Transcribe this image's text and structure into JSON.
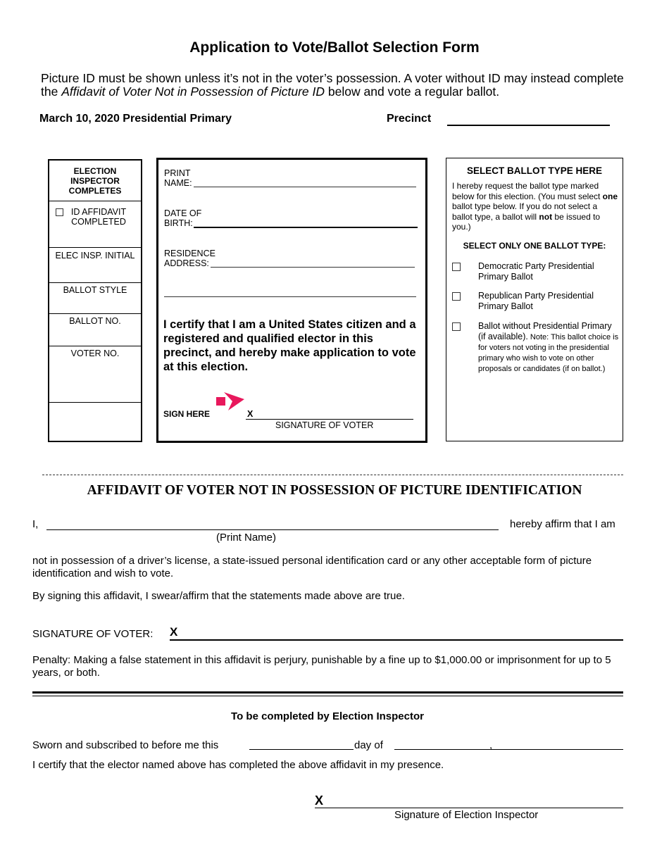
{
  "header": {
    "title": "Application to Vote/Ballot Selection Form",
    "intro_part1": "Picture ID must be shown unless it’s not in the voter’s possession. A voter without ID may instead complete the ",
    "intro_italic": "Affidavit of Voter Not in Possession of Picture ID",
    "intro_part2": " below and vote a regular ballot.",
    "election": "March 10, 2020 Presidential Primary",
    "precinct_label": "Precinct",
    "precinct_value": ""
  },
  "inspector_box": {
    "heading": "ELECTION INSPECTOR COMPLETES",
    "id_affidavit": "ID AFFIDAVIT COMPLETED",
    "id_affidavit_checked": false,
    "initial": "ELEC INSP. INITIAL",
    "ballot_style": "BALLOT STYLE",
    "ballot_no": "BALLOT NO.",
    "voter_no": "VOTER NO."
  },
  "voter_box": {
    "print_name_label_1": "PRINT",
    "print_name_label_2": "NAME:",
    "print_name_value": "",
    "dob_label_1": "DATE OF",
    "dob_label_2": "BIRTH:",
    "dob_value": "",
    "address_label_1": "RESIDENCE",
    "address_label_2": "ADDRESS:",
    "address_value": "",
    "address_line2_value": "",
    "certify": "I certify that I am a United States citizen and a registered and qualified elector in this precinct, and hereby make application to vote at this election.",
    "sign_here": "SIGN HERE",
    "arrow_color": "#e8185c",
    "sig_x": "X",
    "sig_caption": "SIGNATURE OF VOTER"
  },
  "ballot_box": {
    "heading": "SELECT BALLOT TYPE HERE",
    "desc_1": "I hereby request the ballot type marked below for this election.  (You must select ",
    "desc_bold_1": "one",
    "desc_2": " ballot type below.  If you do not select a ballot type, a ballot will ",
    "desc_bold_2": "not",
    "desc_3": " be issued to you.)",
    "only_one": "SELECT ONLY ONE BALLOT TYPE:",
    "options": [
      {
        "label": "Democratic Party Presidential Primary Ballot",
        "checked": false
      },
      {
        "label": "Republican Party Presidential Primary Ballot",
        "checked": false
      },
      {
        "label": "Ballot without Presidential Primary (if available).",
        "note": " Note:  This ballot choice is for voters not voting in the presidential primary who wish to vote on other proposals or candidates (if on ballot.)",
        "checked": false
      }
    ]
  },
  "affidavit": {
    "title": "AFFIDAVIT OF VOTER NOT IN POSSESSION OF PICTURE IDENTIFICATION",
    "i_label": "I,",
    "name_value": "",
    "affirm": "hereby affirm that I am",
    "print_name_caption": "(Print Name)",
    "statement": "not in possession of a driver’s license, a state-issued personal identification card or any other acceptable form of picture identification and wish to vote.",
    "swear": "By signing this affidavit, I swear/affirm that the statements made above are true.",
    "sig_label": "SIGNATURE OF VOTER:",
    "sig_x": "X",
    "penalty": "Penalty:  Making a false statement in this affidavit is perjury, punishable by a fine up to $1,000.00 or imprisonment for up to 5 years, or both."
  },
  "inspector_section": {
    "title": "To be completed by Election Inspector",
    "sworn": "Sworn and subscribed to before me this",
    "day_of": "day of",
    "comma": ",",
    "certify": "I certify that the elector named above has completed the above affidavit in my presence.",
    "sig_x": "X",
    "sig_caption": "Signature of Election Inspector"
  }
}
